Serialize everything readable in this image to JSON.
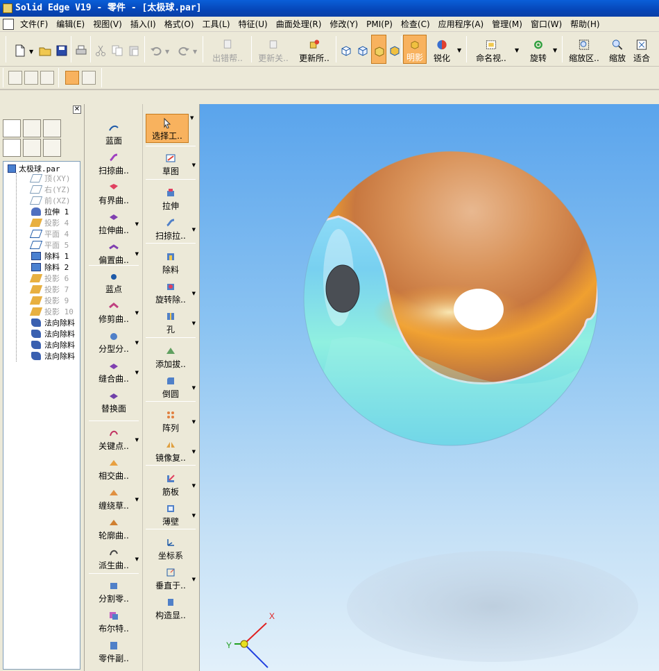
{
  "window": {
    "title": "Solid Edge V19 - 零件 - [太极球.par]"
  },
  "menu": [
    {
      "label": "文件(F)"
    },
    {
      "label": "编辑(E)"
    },
    {
      "label": "视图(V)"
    },
    {
      "label": "插入(I)"
    },
    {
      "label": "格式(O)"
    },
    {
      "label": "工具(L)"
    },
    {
      "label": "特征(U)"
    },
    {
      "label": "曲面处理(R)"
    },
    {
      "label": "修改(Y)"
    },
    {
      "label": "PMI(P)"
    },
    {
      "label": "检查(C)"
    },
    {
      "label": "应用程序(A)"
    },
    {
      "label": "管理(M)"
    },
    {
      "label": "窗口(W)"
    },
    {
      "label": "帮助(H)"
    }
  ],
  "toolbar": {
    "error_assistant": "出错帮..",
    "update_related": "更新关..",
    "update_all": "更新所..",
    "shaded": "明影",
    "sharpen": "锐化",
    "named_view": "命名视..",
    "rotate": "旋转",
    "zoom_area": "缩放区..",
    "zoom": "缩放",
    "fit": "适合"
  },
  "pathfinder": {
    "root": "太极球.par",
    "items": [
      {
        "label": "顶(XY)",
        "dim": true
      },
      {
        "label": "右(YZ)",
        "dim": true
      },
      {
        "label": "前(XZ)",
        "dim": true
      },
      {
        "label": "拉伸 1",
        "dim": false
      },
      {
        "label": "投影 4",
        "dim": true
      },
      {
        "label": "平面 4",
        "dim": true
      },
      {
        "label": "平面 5",
        "dim": true
      },
      {
        "label": "除料 1",
        "dim": false
      },
      {
        "label": "除料 2",
        "dim": false
      },
      {
        "label": "投影 6",
        "dim": true
      },
      {
        "label": "投影 7",
        "dim": true
      },
      {
        "label": "投影 9",
        "dim": true
      },
      {
        "label": "投影 10",
        "dim": true
      },
      {
        "label": "法向除料",
        "dim": false
      },
      {
        "label": "法向除料",
        "dim": false
      },
      {
        "label": "法向除料",
        "dim": false
      },
      {
        "label": "法向除料",
        "dim": false
      }
    ]
  },
  "features_left": [
    {
      "label": "蓝面"
    },
    {
      "label": "扫掠曲.."
    },
    {
      "label": "有界曲.."
    },
    {
      "label": "拉伸曲.."
    },
    {
      "label": "偏置曲.."
    },
    {
      "label": "蓝点"
    },
    {
      "label": "修剪曲.."
    },
    {
      "label": "分型分.."
    },
    {
      "label": "缝合曲.."
    },
    {
      "label": "替换面"
    },
    {
      "label": "关键点.."
    },
    {
      "label": "相交曲.."
    },
    {
      "label": "缠绕草.."
    },
    {
      "label": "轮廓曲.."
    },
    {
      "label": "派生曲.."
    },
    {
      "label": "分割零.."
    },
    {
      "label": "布尔特.."
    },
    {
      "label": "零件副.."
    }
  ],
  "features_right": [
    {
      "label": "选择工.."
    },
    {
      "label": "草图"
    },
    {
      "label": "拉伸"
    },
    {
      "label": "扫掠拉.."
    },
    {
      "label": "除料"
    },
    {
      "label": "旋转除.."
    },
    {
      "label": "孔"
    },
    {
      "label": "添加拔.."
    },
    {
      "label": "倒圆"
    },
    {
      "label": "阵列"
    },
    {
      "label": "镜像复.."
    },
    {
      "label": "筋板"
    },
    {
      "label": "薄壁"
    },
    {
      "label": "坐标系"
    },
    {
      "label": "垂直于.."
    },
    {
      "label": "构造显.."
    }
  ],
  "triad": {
    "x": "X",
    "y": "Y"
  },
  "colors": {
    "accent_active": "#f8b25e",
    "titlebar": "#0a5fd8",
    "sphere_copper": "#d9935a",
    "sphere_cyan": "#8ee6ea"
  }
}
